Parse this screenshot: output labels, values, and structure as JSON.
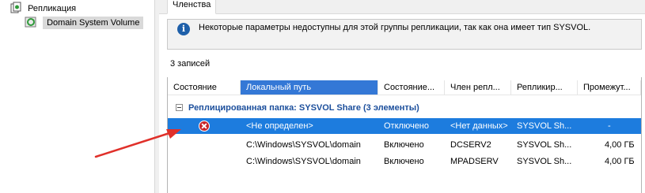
{
  "tree": {
    "items": [
      {
        "label": "Репликация",
        "icon": "replication-icon"
      },
      {
        "label": "Domain System Volume",
        "icon": "replication-group-icon"
      }
    ]
  },
  "tabs": [
    {
      "label": "Членства"
    }
  ],
  "info": {
    "icon": "info-icon",
    "text": "Некоторые параметры недоступны для этой группы репликации, так как она имеет тип SYSVOL."
  },
  "record_count": "3 записей",
  "columns": [
    "Состояние",
    "Локальный путь",
    "Состояние...",
    "Член репл...",
    "Репликир...",
    "Промежут..."
  ],
  "group": {
    "label": "Реплицированная папка: SYSVOL Share (3 элементы)"
  },
  "rows": [
    {
      "status_icon": "error-icon",
      "local_path": "<Не определен>",
      "state": "Отключено",
      "member": "<Нет данных>",
      "replicated_folder": "SYSVOL Sh...",
      "staging": "-"
    },
    {
      "status_icon": "",
      "local_path": "C:\\Windows\\SYSVOL\\domain",
      "state": "Включено",
      "member": "DCSERV2",
      "replicated_folder": "SYSVOL Sh...",
      "staging": "4,00 ГБ"
    },
    {
      "status_icon": "",
      "local_path": "C:\\Windows\\SYSVOL\\domain",
      "state": "Включено",
      "member": "MPADSERV",
      "replicated_folder": "SYSVOL Sh...",
      "staging": "4,00 ГБ"
    }
  ],
  "colors": {
    "selection": "#1d7cde",
    "header_active": "#3478d6",
    "group_text": "#1c4f9c",
    "annotation_arrow": "#e0302a"
  }
}
